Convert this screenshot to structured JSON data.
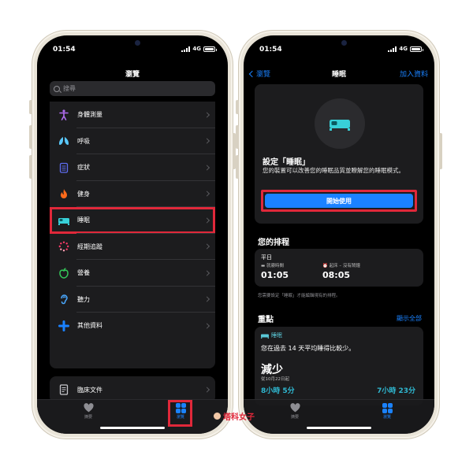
{
  "left": {
    "status": {
      "time": "01:54",
      "network": "4G"
    },
    "title": "瀏覽",
    "search_placeholder": "搜尋",
    "categories": [
      {
        "label": "身體測量",
        "icon": "figure-icon",
        "color": "#b06cf0"
      },
      {
        "label": "呼吸",
        "icon": "lungs-icon",
        "color": "#5ac8fa"
      },
      {
        "label": "症狀",
        "icon": "clipboard-icon",
        "color": "#5e6cf0"
      },
      {
        "label": "健身",
        "icon": "flame-icon",
        "color": "#ff6a1a"
      },
      {
        "label": "睡眠",
        "icon": "bed-icon",
        "color": "#38d0d8"
      },
      {
        "label": "經期追蹤",
        "icon": "cycle-icon",
        "color": "#ff3b6a"
      },
      {
        "label": "營養",
        "icon": "apple-icon",
        "color": "#34c759"
      },
      {
        "label": "聽力",
        "icon": "ear-icon",
        "color": "#4aa8ff"
      },
      {
        "label": "其他資料",
        "icon": "plus-icon",
        "color": "#1a82ff"
      }
    ],
    "clinical_docs": "臨床文件",
    "tabs": {
      "summary": "摘要",
      "browse": "瀏覽"
    }
  },
  "right": {
    "status": {
      "time": "01:54",
      "network": "4G"
    },
    "back": "瀏覽",
    "title": "睡眠",
    "add_data": "加入資料",
    "setup": {
      "heading": "設定「睡眠」",
      "body": "您的裝置可以改善您的睡眠品質並瞭解您的睡眠模式。",
      "button": "開始使用"
    },
    "schedule": {
      "heading": "您的排程",
      "day": "平日",
      "bedtime_label": "就寢時間",
      "bedtime": "01:05",
      "wake_label": "起床 – 沒有鬧鐘",
      "wake": "08:05",
      "note": "您需要設定「睡眠」才能編輯現有的排程。"
    },
    "highlights": {
      "heading": "重點",
      "show_all": "顯示全部",
      "tag": "睡眠",
      "text": "您在過去 14 天平均睡得比較少。",
      "big": "減少",
      "date": "從10月22日起",
      "value_a": "8小時 5分",
      "value_b": "7小時 23分"
    },
    "tabs": {
      "summary": "摘要",
      "browse": "瀏覽"
    }
  },
  "watermark": "塔科女子",
  "colors": {
    "accent": "#1a82ff",
    "highlight": "#e0283a",
    "sleep": "#38d0d8"
  }
}
